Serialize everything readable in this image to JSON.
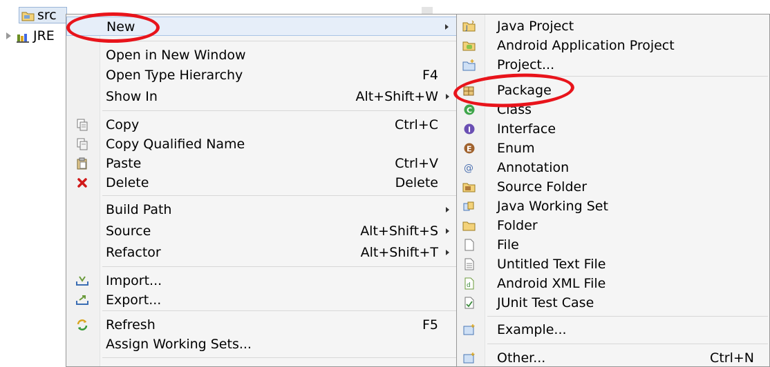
{
  "tree": {
    "src_label": "src",
    "jre_label": "JRE"
  },
  "context_menu": {
    "items": [
      {
        "label": "New",
        "accel": "",
        "icon": "",
        "submenu": true
      },
      {
        "label": "Open in New Window",
        "accel": "",
        "icon": "",
        "submenu": false
      },
      {
        "label": "Open Type Hierarchy",
        "accel": "F4",
        "icon": "",
        "submenu": false
      },
      {
        "label": "Show In",
        "accel": "Alt+Shift+W",
        "icon": "",
        "submenu": true
      },
      {
        "label": "Copy",
        "accel": "Ctrl+C",
        "icon": "copy-icon",
        "submenu": false
      },
      {
        "label": "Copy Qualified Name",
        "accel": "",
        "icon": "copy-qualified-icon",
        "submenu": false
      },
      {
        "label": "Paste",
        "accel": "Ctrl+V",
        "icon": "paste-icon",
        "submenu": false
      },
      {
        "label": "Delete",
        "accel": "Delete",
        "icon": "delete-icon",
        "submenu": false
      },
      {
        "label": "Build Path",
        "accel": "",
        "icon": "",
        "submenu": true
      },
      {
        "label": "Source",
        "accel": "Alt+Shift+S",
        "icon": "",
        "submenu": true
      },
      {
        "label": "Refactor",
        "accel": "Alt+Shift+T",
        "icon": "",
        "submenu": true
      },
      {
        "label": "Import...",
        "accel": "",
        "icon": "import-icon",
        "submenu": false
      },
      {
        "label": "Export...",
        "accel": "",
        "icon": "export-icon",
        "submenu": false
      },
      {
        "label": "Refresh",
        "accel": "F5",
        "icon": "refresh-icon",
        "submenu": false
      },
      {
        "label": "Assign Working Sets...",
        "accel": "",
        "icon": "",
        "submenu": false
      }
    ]
  },
  "new_submenu": {
    "items": [
      {
        "label": "Java Project",
        "accel": "",
        "icon": "java-project-icon"
      },
      {
        "label": "Android Application Project",
        "accel": "",
        "icon": "android-project-icon"
      },
      {
        "label": "Project...",
        "accel": "",
        "icon": "project-icon"
      },
      {
        "label": "Package",
        "accel": "",
        "icon": "package-icon"
      },
      {
        "label": "Class",
        "accel": "",
        "icon": "class-icon"
      },
      {
        "label": "Interface",
        "accel": "",
        "icon": "interface-icon"
      },
      {
        "label": "Enum",
        "accel": "",
        "icon": "enum-icon"
      },
      {
        "label": "Annotation",
        "accel": "",
        "icon": "annotation-icon"
      },
      {
        "label": "Source Folder",
        "accel": "",
        "icon": "source-folder-icon"
      },
      {
        "label": "Java Working Set",
        "accel": "",
        "icon": "working-set-icon"
      },
      {
        "label": "Folder",
        "accel": "",
        "icon": "folder-icon"
      },
      {
        "label": "File",
        "accel": "",
        "icon": "file-icon"
      },
      {
        "label": "Untitled Text File",
        "accel": "",
        "icon": "text-file-icon"
      },
      {
        "label": "Android XML File",
        "accel": "",
        "icon": "android-xml-icon"
      },
      {
        "label": "JUnit Test Case",
        "accel": "",
        "icon": "junit-icon"
      },
      {
        "label": "Example...",
        "accel": "",
        "icon": "example-icon"
      },
      {
        "label": "Other...",
        "accel": "Ctrl+N",
        "icon": "other-icon"
      }
    ]
  },
  "colors": {
    "highlight_ring": "#e8141b",
    "menu_bg": "#f5f5f5"
  }
}
